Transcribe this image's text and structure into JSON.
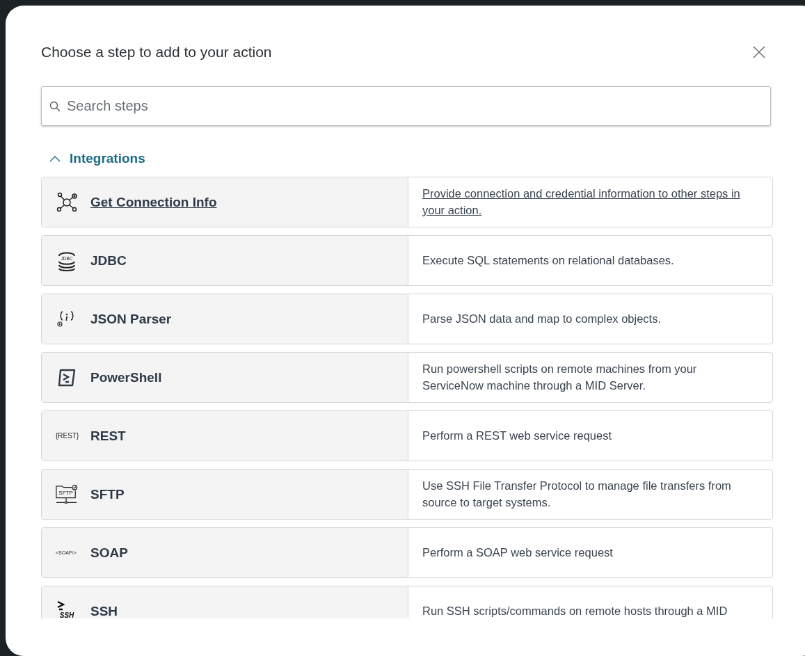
{
  "dialog": {
    "title": "Choose a step to add to your action"
  },
  "search": {
    "placeholder": "Search steps"
  },
  "section": {
    "label": "Integrations",
    "expanded": true
  },
  "steps": [
    {
      "kind": "network",
      "name": "Get Connection Info",
      "description": "Provide connection and credential information to other steps in your action.",
      "hovered": true
    },
    {
      "kind": "database",
      "icon_label": "JDBC",
      "name": "JDBC",
      "description": "Execute SQL statements on relational databases.",
      "hovered": false
    },
    {
      "kind": "json",
      "name": "JSON Parser",
      "description": "Parse JSON data and map to complex objects.",
      "hovered": false
    },
    {
      "kind": "terminal",
      "name": "PowerShell",
      "description": "Run powershell scripts on remote machines from your ServiceNow machine through a MID Server.",
      "hovered": false
    },
    {
      "kind": "text",
      "icon_label": "{REST}",
      "name": "REST",
      "description": "Perform a REST web service request",
      "hovered": false
    },
    {
      "kind": "folder",
      "icon_label": "SFTP",
      "name": "SFTP",
      "description": "Use SSH File Transfer Protocol to manage file transfers from source to target systems.",
      "hovered": false
    },
    {
      "kind": "text",
      "icon_label": "<SOAP/>",
      "name": "SOAP",
      "description": "Perform a SOAP web service request",
      "hovered": false
    },
    {
      "kind": "prompt",
      "icon_label": "SSH",
      "name": "SSH",
      "description": "Run SSH scripts/commands on remote hosts through a MID",
      "hovered": false
    }
  ]
}
